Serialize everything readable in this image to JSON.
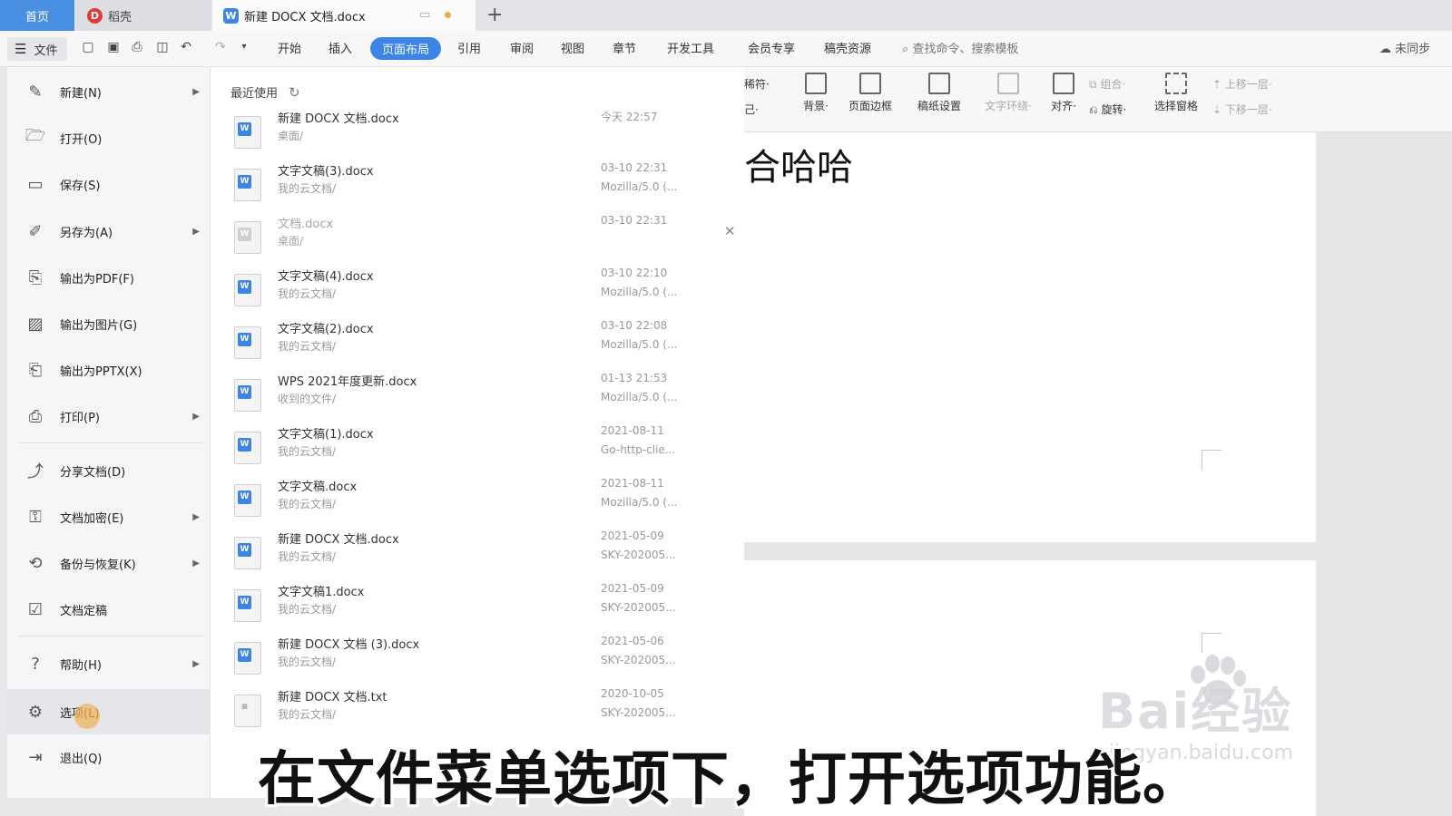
{
  "tabs": {
    "home": "首页",
    "daoke": "稻壳",
    "doc": "新建 DOCX 文档.docx",
    "new_tab": "+"
  },
  "ribbon": {
    "file_label": "文件",
    "tabs": [
      "开始",
      "插入",
      "页面布局",
      "引用",
      "审阅",
      "视图",
      "章节",
      "开发工具",
      "会员专享",
      "稿壳资源"
    ],
    "active_tab": "页面布局",
    "search_placeholder": "查找命令、搜索模板",
    "sync_label": "未同步"
  },
  "toolbar": {
    "left_partial_top": "稀符·",
    "left_partial_bottom": "己·",
    "tools": [
      "背景·",
      "页面边框",
      "稿纸设置",
      "文字环绕·",
      "对齐·",
      "旋转·",
      "选择窗格"
    ],
    "group_label": "组合·",
    "move_up": "上移一层·",
    "move_down": "下移一层·"
  },
  "file_menu": {
    "items": [
      {
        "label": "新建(N)",
        "icon": "new-doc-icon",
        "arrow": true
      },
      {
        "label": "打开(O)",
        "icon": "folder-open-icon",
        "arrow": false
      },
      {
        "label": "保存(S)",
        "icon": "save-icon",
        "arrow": false
      },
      {
        "label": "另存为(A)",
        "icon": "save-as-icon",
        "arrow": true
      },
      {
        "label": "输出为PDF(F)",
        "icon": "pdf-icon",
        "arrow": false
      },
      {
        "label": "输出为图片(G)",
        "icon": "image-icon",
        "arrow": false
      },
      {
        "label": "输出为PPTX(X)",
        "icon": "pptx-icon",
        "arrow": false
      },
      {
        "label": "打印(P)",
        "icon": "print-icon",
        "arrow": true
      },
      {
        "label": "分享文档(D)",
        "icon": "share-icon",
        "arrow": false
      },
      {
        "label": "文档加密(E)",
        "icon": "encrypt-icon",
        "arrow": true
      },
      {
        "label": "备份与恢复(K)",
        "icon": "backup-icon",
        "arrow": true
      },
      {
        "label": "文档定稿",
        "icon": "finalize-icon",
        "arrow": false
      },
      {
        "label": "帮助(H)",
        "icon": "help-icon",
        "arrow": true
      },
      {
        "label": "选项(L)",
        "icon": "gear-icon",
        "arrow": false
      },
      {
        "label": "退出(Q)",
        "icon": "exit-icon",
        "arrow": false
      }
    ],
    "selected": "选项(L)"
  },
  "recent": {
    "header": "最近使用",
    "files": [
      {
        "name": "新建 DOCX 文档.docx",
        "path": "桌面/",
        "date": "今天 22:57",
        "meta": "",
        "type": "docx"
      },
      {
        "name": "文字文稿(3).docx",
        "path": "我的云文档/",
        "date": "03-10 22:31",
        "meta": "Mozilla/5.0 (...",
        "type": "docx"
      },
      {
        "name": "文档.docx",
        "path": "桌面/",
        "date": "03-10 22:31",
        "meta": "",
        "type": "docx-missing"
      },
      {
        "name": "文字文稿(4).docx",
        "path": "我的云文档/",
        "date": "03-10 22:10",
        "meta": "Mozilla/5.0 (...",
        "type": "docx"
      },
      {
        "name": "文字文稿(2).docx",
        "path": "我的云文档/",
        "date": "03-10 22:08",
        "meta": "Mozilla/5.0 (...",
        "type": "docx"
      },
      {
        "name": "WPS 2021年度更新.docx",
        "path": "收到的文件/",
        "date": "01-13 21:53",
        "meta": "Mozilla/5.0 (...",
        "type": "docx"
      },
      {
        "name": "文字文稿(1).docx",
        "path": "我的云文档/",
        "date": "2021-08-11",
        "meta": "Go-http-clie...",
        "type": "docx"
      },
      {
        "name": "文字文稿.docx",
        "path": "我的云文档/",
        "date": "2021-08-11",
        "meta": "Mozilla/5.0 (...",
        "type": "docx"
      },
      {
        "name": "新建 DOCX 文档.docx",
        "path": "我的云文档/",
        "date": "2021-05-09",
        "meta": "SKY-202005...",
        "type": "docx"
      },
      {
        "name": "文字文稿1.docx",
        "path": "我的云文档/",
        "date": "2021-05-09",
        "meta": "SKY-202005...",
        "type": "docx"
      },
      {
        "name": "新建 DOCX 文档 (3).docx",
        "path": "我的云文档/",
        "date": "2021-05-06",
        "meta": "SKY-202005...",
        "type": "docx"
      },
      {
        "name": "新建 DOCX 文档.txt",
        "path": "我的云文档/",
        "date": "2020-10-05",
        "meta": "SKY-202005...",
        "type": "txt"
      }
    ]
  },
  "document": {
    "visible_text": "合哈哈"
  },
  "watermark": {
    "logo": "Bai经验",
    "url": "jingyan.baidu.com"
  },
  "subtitle": "在文件菜单选项下，打开选项功能。",
  "colors": {
    "accent": "#3c84e6",
    "home_tab": "#4a90e2",
    "daoke_logo": "#e23b3b"
  }
}
